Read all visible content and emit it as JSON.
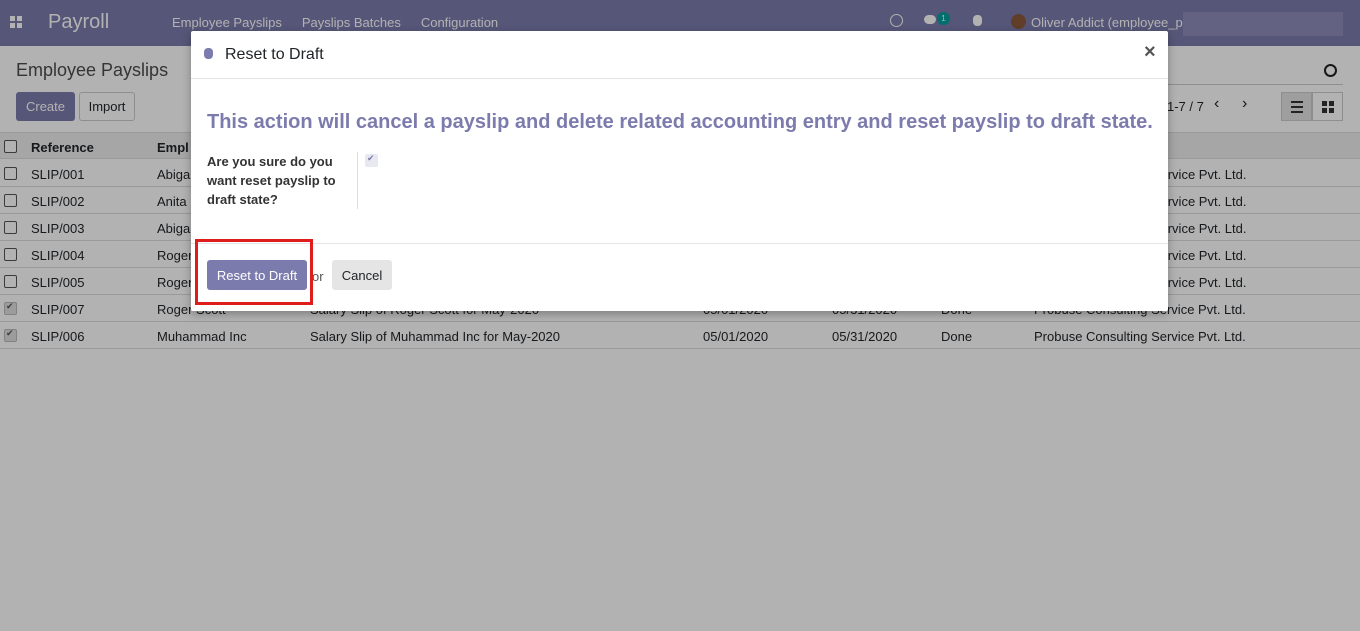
{
  "navbar": {
    "app_title": "Payroll",
    "menu": [
      "Employee Payslips",
      "Payslips Batches",
      "Configuration"
    ],
    "chat_badge": "1",
    "user_name": "Oliver Addict (employee_p",
    "accent_color": "#7c7bad"
  },
  "control_panel": {
    "page_title": "Employee Payslips",
    "create_label": "Create",
    "import_label": "Import",
    "pager_value": "1-7 / 7"
  },
  "table": {
    "headers": [
      "Reference",
      "Empl"
    ],
    "rows": [
      {
        "ref": "SLIP/001",
        "employee": "Abiga",
        "description": "",
        "from": "",
        "to": "",
        "state": "",
        "company": "service Pvt. Ltd.",
        "checked": false
      },
      {
        "ref": "SLIP/002",
        "employee": "Anita",
        "description": "",
        "from": "",
        "to": "",
        "state": "",
        "company": "service Pvt. Ltd.",
        "checked": false
      },
      {
        "ref": "SLIP/003",
        "employee": "Abiga",
        "description": "",
        "from": "",
        "to": "",
        "state": "",
        "company": "service Pvt. Ltd.",
        "checked": false
      },
      {
        "ref": "SLIP/004",
        "employee": "Roger",
        "description": "",
        "from": "",
        "to": "",
        "state": "",
        "company": "service Pvt. Ltd.",
        "checked": false
      },
      {
        "ref": "SLIP/005",
        "employee": "Roger",
        "description": "",
        "from": "",
        "to": "",
        "state": "",
        "company": "service Pvt. Ltd.",
        "checked": false
      },
      {
        "ref": "SLIP/007",
        "employee": "Roger Scott",
        "description": "Salary Slip of Roger Scott for May-2020",
        "from": "05/01/2020",
        "to": "05/31/2020",
        "state": "Done",
        "company": "Probuse Consulting Service Pvt. Ltd.",
        "checked": true
      },
      {
        "ref": "SLIP/006",
        "employee": "Muhammad Inc",
        "description": "Salary Slip of Muhammad Inc for May-2020",
        "from": "05/01/2020",
        "to": "05/31/2020",
        "state": "Done",
        "company": "Probuse Consulting Service Pvt. Ltd.",
        "checked": true
      }
    ]
  },
  "modal": {
    "title": "Reset to Draft",
    "heading": "This action will cancel a payslip and delete related accounting entry and reset payslip to draft state.",
    "field_label": "Are you sure do you want reset payslip to draft state?",
    "field_checked": true,
    "reset_label": "Reset to Draft",
    "or_text": "or",
    "cancel_label": "Cancel",
    "close_symbol": "×"
  }
}
